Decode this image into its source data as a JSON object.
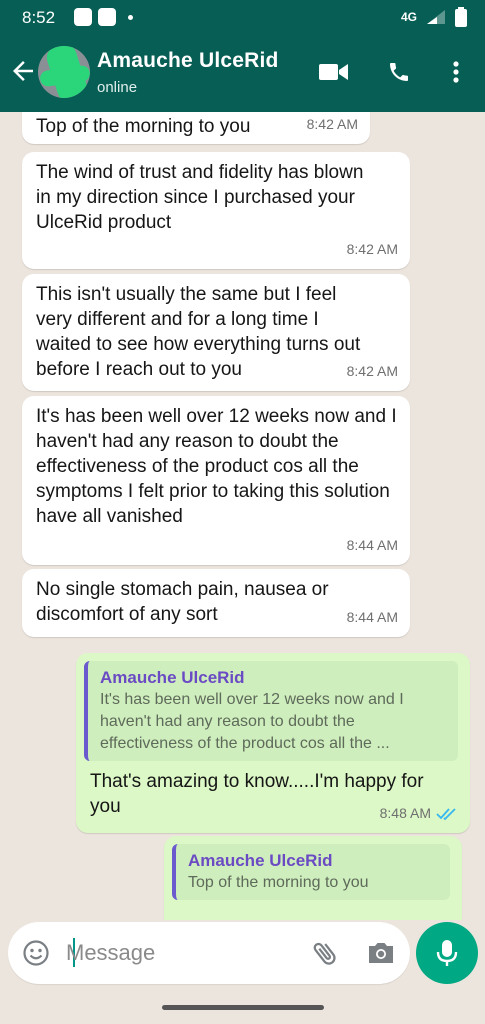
{
  "status_bar": {
    "time": "8:52",
    "network": "4G",
    "icons": [
      "notification-icon",
      "notification-icon",
      "dot",
      "signal-icon",
      "battery-icon"
    ]
  },
  "header": {
    "back_icon": "arrow-left-icon",
    "name": "Amauche UlceRid",
    "status": "online",
    "actions": [
      "video-call-icon",
      "voice-call-icon",
      "more-vert-icon"
    ]
  },
  "messages": [
    {
      "direction": "in",
      "text": "Top of the morning to you",
      "time": "8:42 AM"
    },
    {
      "direction": "in",
      "text": "The wind of trust and fidelity has blown in my direction since I purchased your UlceRid product",
      "time": "8:42 AM"
    },
    {
      "direction": "in",
      "text": "This isn't usually the same but I feel very different and for a long time I waited to see how everything turns out before I reach out to you",
      "time": "8:42 AM"
    },
    {
      "direction": "in",
      "text": "It's has been well over 12 weeks now and I haven't had any reason to doubt the effectiveness of the product cos all the symptoms I felt prior to taking this solution have all vanished",
      "time": "8:44 AM"
    },
    {
      "direction": "in",
      "text": "No single stomach pain, nausea or discomfort of any sort",
      "time": "8:44 AM"
    },
    {
      "direction": "out",
      "quote": {
        "name": "Amauche UlceRid",
        "text": "It's has been well over 12 weeks now and I haven't had any reason to doubt the effectiveness of the product cos all the ..."
      },
      "text": "That's amazing to know.....I'm happy for you",
      "time": "8:48 AM",
      "read_status": "double-check-blue"
    },
    {
      "direction": "out",
      "quote": {
        "name": "Amauche UlceRid",
        "text": "Top of the morning to you"
      }
    }
  ],
  "composer": {
    "placeholder": "Message",
    "icons": [
      "emoji-icon",
      "attach-icon",
      "camera-icon",
      "mic-icon"
    ]
  },
  "colors": {
    "header": "#075e54",
    "chat_background": "#ece5dd",
    "incoming_bubble": "#ffffff",
    "outgoing_bubble": "#dcf8c6",
    "quote_accent": "#6a5acd",
    "mic_button": "#00a884",
    "read_ticks": "#34b7f1"
  }
}
